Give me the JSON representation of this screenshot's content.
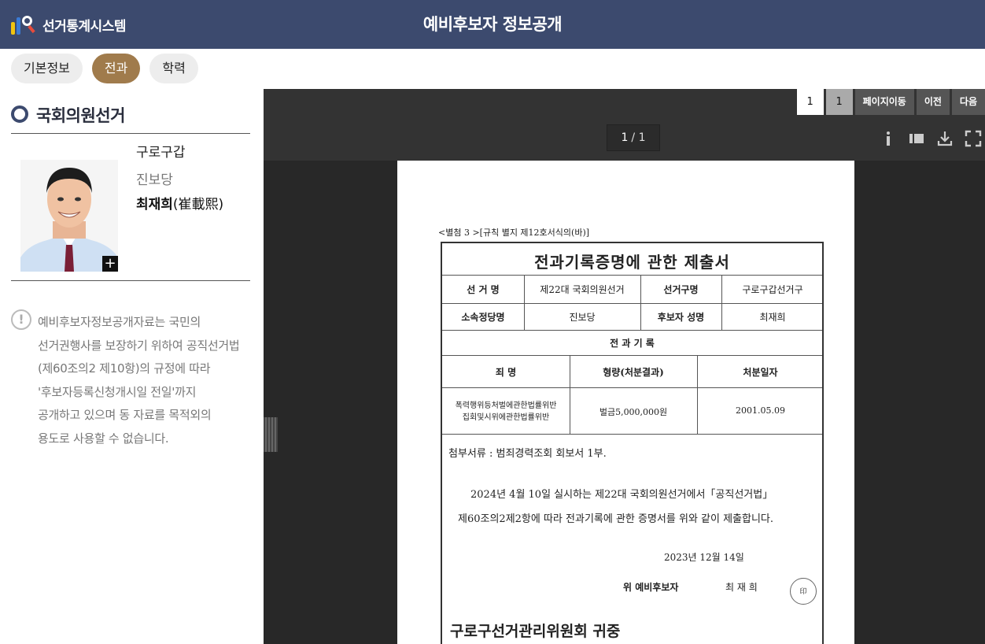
{
  "header": {
    "logo_text": "선거통계시스템",
    "title": "예비후보자 정보공개"
  },
  "tabs": [
    {
      "label": "기본정보"
    },
    {
      "label": "전과"
    },
    {
      "label": "학력"
    }
  ],
  "sidebar": {
    "election_title": "국회의원선거",
    "district": "구로구갑",
    "party": "진보당",
    "name": "최재희",
    "name_hanja": "(崔載熙)",
    "photo_expand_label": "+",
    "notice_icon": "!",
    "notice_lines": [
      "예비후보자정보공개자료는 국민의",
      "선거권행사를 보장하기 위하여 공직선거법",
      "(제60조의2 제10항)의 규정에 따라",
      "'후보자등록신청개시일 전일'까지",
      "공개하고 있으며 동 자료를 목적외의",
      "용도로 사용할 수 없습니다."
    ]
  },
  "viewer": {
    "page_input": "1",
    "page_current_box": "1",
    "goto_label": "페이지이동",
    "prev_label": "이전",
    "next_label": "다음",
    "page_indicator_current": "1",
    "page_indicator_total": "/ 1",
    "icons": [
      "info-icon",
      "sidebar-toggle-icon",
      "download-icon",
      "fullscreen-icon"
    ]
  },
  "document": {
    "form_no": "<별첨 3 >[규칙 별지 제12호서식의(바)]",
    "title": "전과기록증명에 관한 제출서",
    "election_label": "선 거 명",
    "election_value": "제22대 국회의원선거",
    "district_label": "선거구명",
    "district_value": "구로구갑선거구",
    "party_label": "소속정당명",
    "party_value": "진보당",
    "candidate_label": "후보자 성명",
    "candidate_value": "최재희",
    "record_header": "전 과 기 록",
    "col_crime": "죄 명",
    "col_penalty": "형량(처분결과)",
    "col_date": "처분일자",
    "crime_line1": "폭력행위등처벌에관한법률위반",
    "crime_line2": "집회및시위에관한법률위반",
    "penalty": "벌금5,000,000원",
    "date": "2001.05.09",
    "attachment": "첨부서류 : 범죄경력조회 회보서 1부.",
    "body_line1": "2024년 4월 10일 실시하는    제22대  국회의원선거에서「공직선거법」",
    "body_line2": "제60조의2제2항에 따라 전과기록에 관한 증명서를 위와 같이 제출합니다.",
    "submit_date": "2023년     12월     14일",
    "signer_label": "위    예비후보자",
    "signer_name": "최 재 희",
    "seal_text": "印",
    "addressee": "구로구선거관리위원회 귀중"
  }
}
